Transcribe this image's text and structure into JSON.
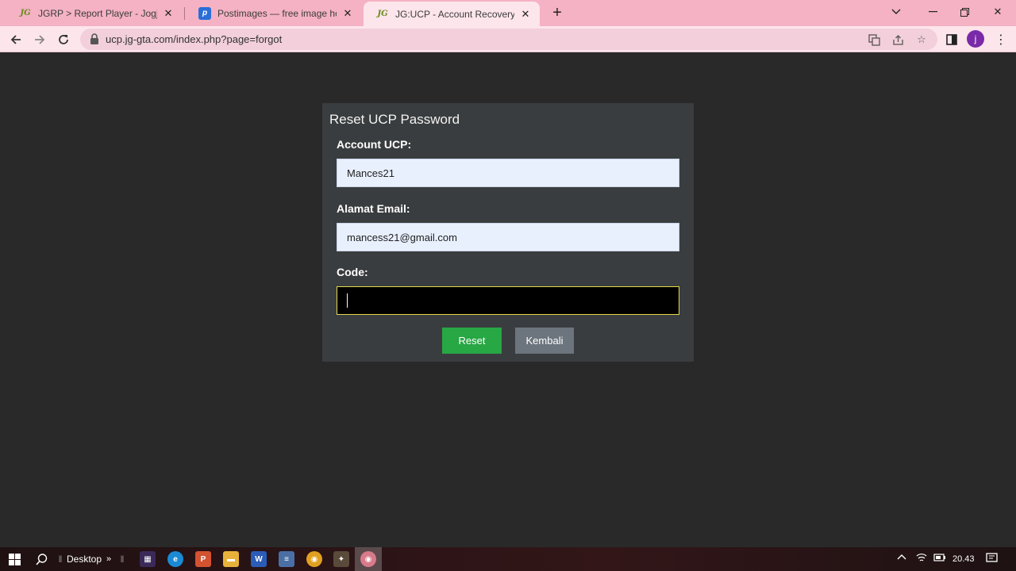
{
  "browser": {
    "tabs": [
      {
        "title": "JGRP > Report Player - Jogjagam",
        "favicon": "jg-logo-icon",
        "active": false
      },
      {
        "title": "Postimages — free image hosting",
        "favicon": "postimages-icon",
        "active": false
      },
      {
        "title": "JG:UCP - Account Recovery",
        "favicon": "jg-logo-icon",
        "active": true
      }
    ],
    "url": "ucp.jg-gta.com/index.php?page=forgot",
    "profile_initial": "j"
  },
  "form": {
    "title": "Reset UCP Password",
    "account_label": "Account UCP:",
    "account_value": "Mances21",
    "email_label": "Alamat Email:",
    "email_value": "mancess21@gmail.com",
    "code_label": "Code:",
    "code_value": "",
    "reset_label": "Reset",
    "back_label": "Kembali"
  },
  "taskbar": {
    "desktop_label": "Desktop",
    "time": "20.43"
  },
  "colors": {
    "tabstrip": "#f4b2c4",
    "active_tab": "#fde5ec",
    "page_bg": "#292929",
    "card_bg": "#3a3d3f",
    "reset_button": "#28a745",
    "back_button": "#6c757d"
  }
}
